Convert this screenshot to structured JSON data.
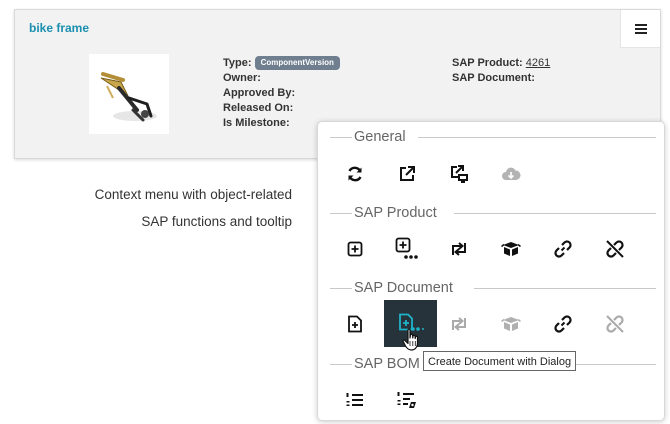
{
  "card": {
    "title": "bike frame",
    "menu_icon": "hamburger-menu-icon",
    "thumbnail": "bike-frame-3d-thumbnail",
    "type_label": "Type:",
    "type_value": "ComponentVersion",
    "owner_label": "Owner:",
    "approved_label": "Approved By:",
    "released_label": "Released On:",
    "milestone_label": "Is Milestone:",
    "sap_product_label": "SAP Product:",
    "sap_product_value": "4261",
    "sap_document_label": "SAP Document:"
  },
  "caption": {
    "line1": "Context menu with object-related",
    "line2": "SAP functions and tooltip"
  },
  "menu": {
    "sections": {
      "general": "General",
      "sap_product": "SAP Product",
      "sap_document": "SAP Document",
      "sap_bom": "SAP BOM"
    },
    "general_icons": [
      "refresh-icon",
      "open-external-icon",
      "open-in-desktop-icon",
      "cloud-download-icon"
    ],
    "sap_product_icons": [
      "create-icon",
      "create-with-dialog-icon",
      "transfer-icon",
      "package-icon",
      "link-icon",
      "unlink-icon"
    ],
    "sap_document_icons": [
      "create-document-icon",
      "create-document-with-dialog-icon",
      "transfer-icon",
      "package-icon",
      "link-icon",
      "unlink-icon"
    ],
    "sap_bom_icons": [
      "bom-list-icon",
      "bom-edit-icon"
    ]
  },
  "tooltip": {
    "text": "Create Document with Dialog"
  },
  "colors": {
    "accent": "#1a8fb0",
    "badge": "#6f7f8f",
    "active_button": "#26333a",
    "active_icon": "#1fb3c8"
  }
}
